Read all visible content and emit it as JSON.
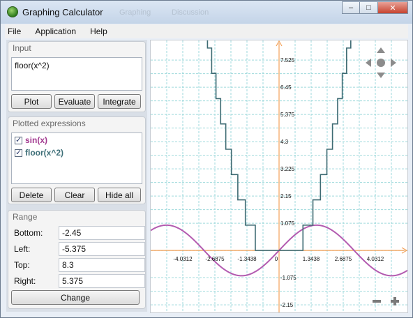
{
  "window": {
    "title": "Graphing Calculator",
    "ghost_tabs": [
      "Graphing",
      "Discussion"
    ],
    "buttons": {
      "minimize": "‒",
      "maximize": "□",
      "close": "✕"
    }
  },
  "menu": [
    "File",
    "Application",
    "Help"
  ],
  "input_group": {
    "title": "Input",
    "expression": "floor(x^2)",
    "buttons": {
      "plot": "Plot",
      "evaluate": "Evaluate",
      "integrate": "Integrate"
    }
  },
  "plotted_group": {
    "title": "Plotted expressions",
    "items": [
      {
        "label": "sin(x)",
        "color": "#a2398f",
        "checked": true
      },
      {
        "label": "floor(x^2)",
        "color": "#3e6f78",
        "checked": true
      }
    ],
    "buttons": {
      "delete": "Delete",
      "clear": "Clear",
      "hide_all": "Hide all"
    }
  },
  "range_group": {
    "title": "Range",
    "fields": [
      {
        "label": "Bottom:",
        "value": "-2.45"
      },
      {
        "label": "Left:",
        "value": "-5.375"
      },
      {
        "label": "Top:",
        "value": "8.3"
      },
      {
        "label": "Right:",
        "value": "5.375"
      }
    ],
    "button": "Change"
  },
  "chart_data": {
    "type": "line",
    "xlim": [
      -5.375,
      5.375
    ],
    "ylim": [
      -2.45,
      8.3
    ],
    "x_ticks": [
      "-4.0312",
      "-2.6875",
      "-1.3438",
      "0",
      "1.3438",
      "2.6875",
      "4.0312"
    ],
    "y_ticks": [
      "7.525",
      "6.45",
      "5.375",
      "4.3",
      "3.225",
      "2.15",
      "1.075",
      "-1.075",
      "-2.15"
    ],
    "series": [
      {
        "name": "sin(x)",
        "function": "sin",
        "color": "#b35bb0"
      },
      {
        "name": "floor(x^2)",
        "function": "floor_sq",
        "color": "#3e6b73"
      }
    ],
    "grid": true,
    "axis_color": "#f4a25a",
    "controls": {
      "pan": [
        "up",
        "left",
        "center",
        "right",
        "down"
      ],
      "zoom": [
        "-",
        "+"
      ]
    }
  }
}
